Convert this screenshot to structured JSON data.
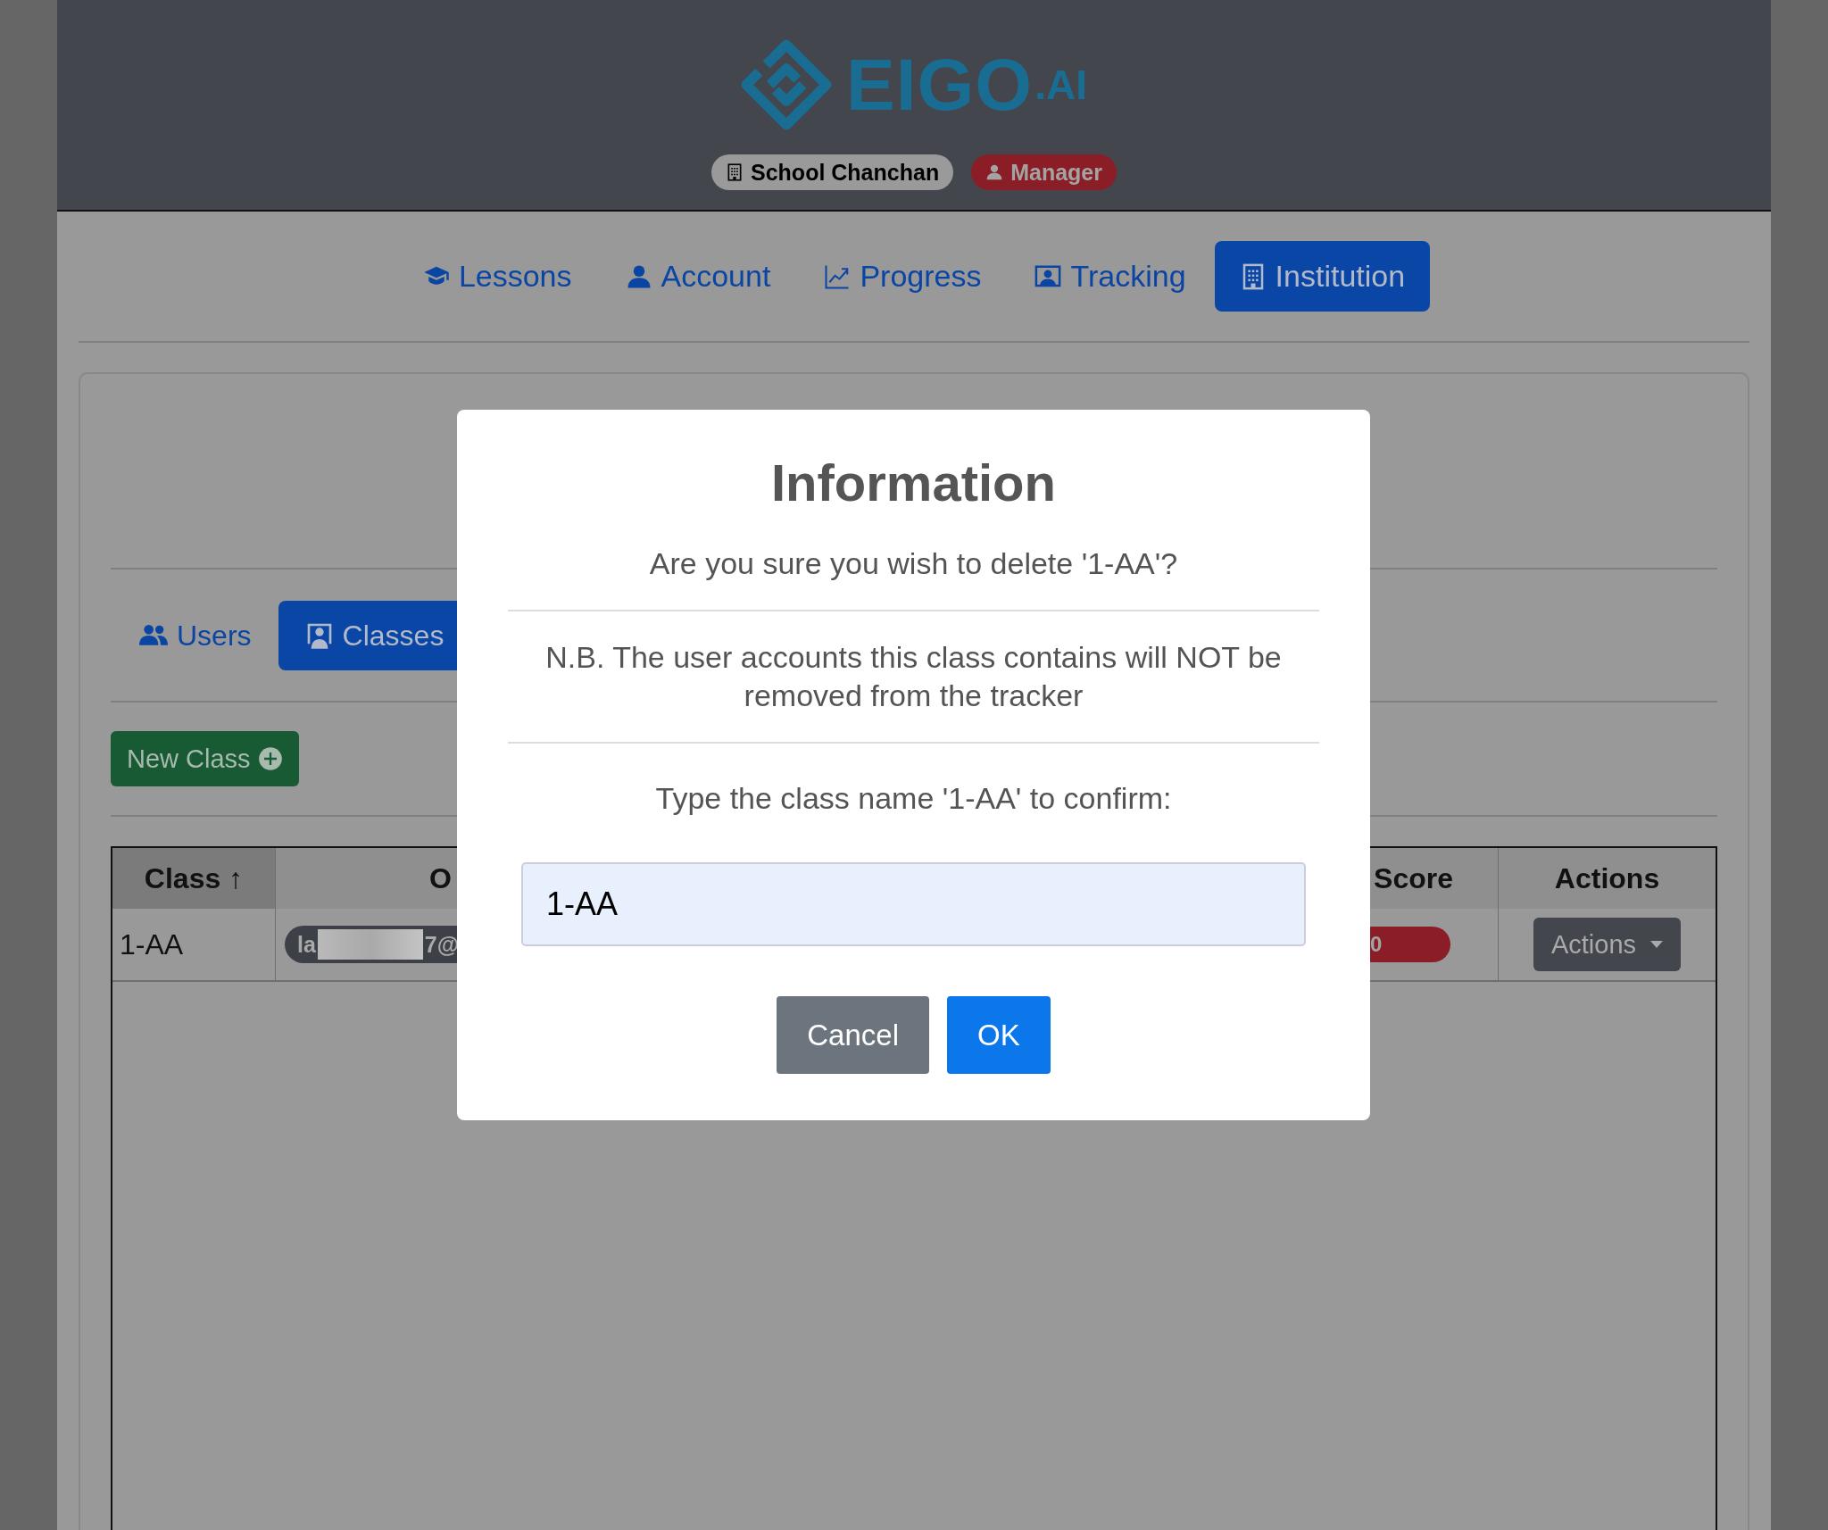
{
  "header": {
    "logo": {
      "name": "EIGO",
      "suffix": ".AI"
    },
    "badges": [
      {
        "kind": "school",
        "label": "School Chanchan"
      },
      {
        "kind": "role",
        "label": "Manager"
      }
    ]
  },
  "nav": [
    {
      "label": "Lessons",
      "selected": false
    },
    {
      "label": "Account",
      "selected": false
    },
    {
      "label": "Progress",
      "selected": false
    },
    {
      "label": "Tracking",
      "selected": false
    },
    {
      "label": "Institution",
      "selected": true
    }
  ],
  "tabs": [
    {
      "label": "Users",
      "selected": false
    },
    {
      "label": "Classes",
      "selected": true
    }
  ],
  "new_class_button": "New Class",
  "table": {
    "columns": [
      {
        "label": "Class ↑",
        "sorted": true
      },
      {
        "label": "O",
        "sorted": false
      },
      {
        "label": "Score",
        "sorted": false
      },
      {
        "label": "Actions",
        "sorted": false
      }
    ],
    "rows": [
      {
        "class": "1-AA",
        "owner_start": "la",
        "owner_end": "7@",
        "score": "0",
        "actions": "Actions"
      }
    ]
  },
  "modal": {
    "title": "Information",
    "message": "Are you sure you wish to delete '1-AA'?",
    "note": "N.B. The user accounts this class contains will NOT be removed from the tracker",
    "prompt": "Type the class name '1-AA' to confirm:",
    "input": {
      "value": "1-AA"
    },
    "buttons": [
      {
        "kind": "secondary",
        "label": "Cancel"
      },
      {
        "kind": "primary",
        "label": "OK"
      }
    ]
  }
}
